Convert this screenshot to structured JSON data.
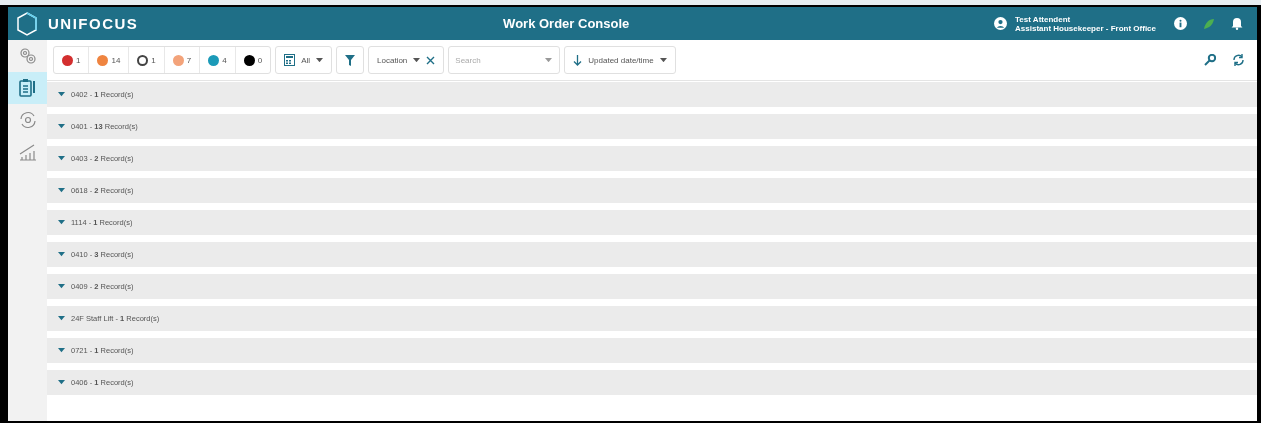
{
  "header": {
    "brand": "UNIFOCUS",
    "title": "Work Order Console",
    "user_name": "Test Attendent",
    "user_role": "Assistant Housekeeper - Front Office"
  },
  "sidebar": {
    "items": [
      {
        "kind": "gears",
        "selected": false
      },
      {
        "kind": "clipboard",
        "selected": true
      },
      {
        "kind": "refresh",
        "selected": false
      },
      {
        "kind": "chart",
        "selected": false
      }
    ]
  },
  "toolbar": {
    "counters": [
      {
        "kind": "dot",
        "color": "#d32f2f",
        "count": "1"
      },
      {
        "kind": "dot",
        "color": "#ef8440",
        "count": "14"
      },
      {
        "kind": "ring",
        "color": "#444444",
        "count": "1"
      },
      {
        "kind": "dot",
        "color": "#f3a37a",
        "count": "7"
      },
      {
        "kind": "dot",
        "color": "#1b9ab8",
        "count": "4"
      },
      {
        "kind": "dot",
        "color": "#000000",
        "count": "0"
      }
    ],
    "category": "All",
    "location": "Location",
    "search": {
      "placeholder": "Search"
    },
    "sort": "Updated date/time"
  },
  "groups": [
    {
      "label": "0402 - **1** Record(s)",
      "expanded": true
    },
    {
      "label": "0401 - **13** Record(s)",
      "expanded": true
    },
    {
      "label": "0403 - **2** Record(s)",
      "expanded": true
    },
    {
      "label": "0618 - **2** Record(s)",
      "expanded": true
    },
    {
      "label": "1114 - **1** Record(s)",
      "expanded": true
    },
    {
      "label": "0410 - **3** Record(s)",
      "expanded": true
    },
    {
      "label": "0409 - **2** Record(s)",
      "expanded": true
    },
    {
      "label": "24F Staff Lift - **1** Record(s)",
      "expanded": true
    },
    {
      "label": "0721 - **1** Record(s)",
      "expanded": true
    },
    {
      "label": "0406 - **1** Record(s)",
      "expanded": true
    }
  ]
}
